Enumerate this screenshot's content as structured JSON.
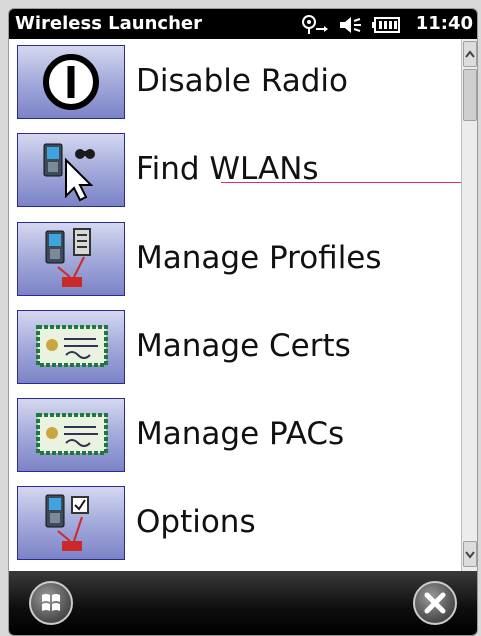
{
  "window": {
    "title": "Wireless Launcher",
    "clock": "11:40"
  },
  "status_icons": [
    "wifi-connectivity-icon",
    "speaker-muted-icon",
    "battery-icon"
  ],
  "menu": {
    "items": [
      {
        "label": "Disable Radio",
        "icon": "power-icon"
      },
      {
        "label": "Find WLANs",
        "icon": "find-wlans-icon"
      },
      {
        "label": "Manage Profiles",
        "icon": "profiles-icon"
      },
      {
        "label": "Manage Certs",
        "icon": "certificate-icon"
      },
      {
        "label": "Manage PACs",
        "icon": "pac-icon"
      },
      {
        "label": "Options",
        "icon": "options-icon"
      }
    ]
  },
  "softkeys": {
    "left": "windows-start-icon",
    "right": "close-icon"
  },
  "colors": {
    "tile_border": "#2b2b8f",
    "annotation_line": "#d4306a"
  }
}
